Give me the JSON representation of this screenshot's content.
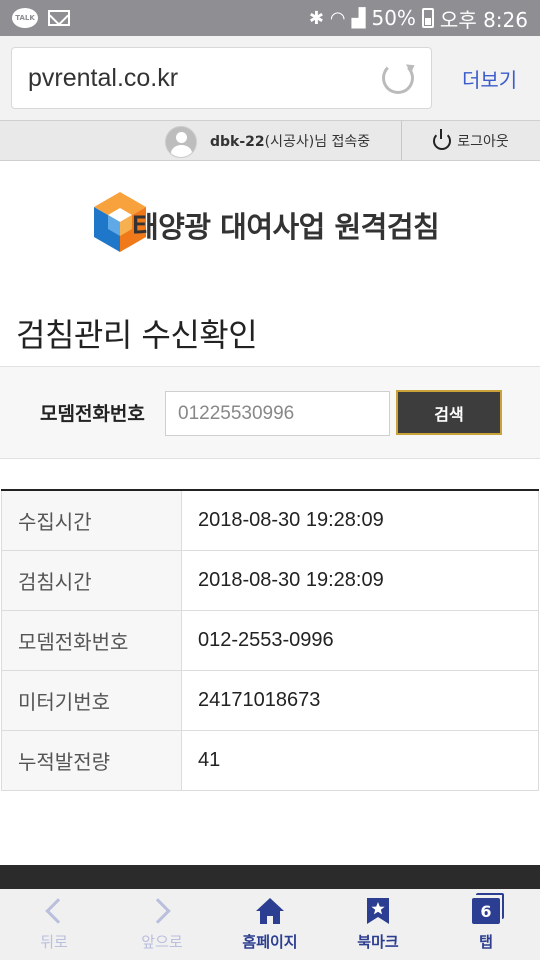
{
  "status_bar": {
    "app_icon_text": "TALK",
    "battery": "50%",
    "time": "오후 8:26"
  },
  "browser": {
    "url": "pvrental.co.kr",
    "more_label": "더보기"
  },
  "session": {
    "user_id": "dbk-22",
    "role_suffix": "(시공사)님 접속중",
    "logout_label": "로그아웃"
  },
  "logo": {
    "text": "태양광 대여사업 원격검침",
    "colors": {
      "blue": "#1f77c9",
      "orange": "#f07a1a"
    }
  },
  "page": {
    "title": "검침관리 수신확인"
  },
  "search": {
    "label": "모뎀전화번호",
    "value": "01225530996",
    "button_label": "검색"
  },
  "table": {
    "rows": [
      {
        "label": "수집시간",
        "value": "2018-08-30 19:28:09"
      },
      {
        "label": "검침시간",
        "value": "2018-08-30 19:28:09"
      },
      {
        "label": "모뎀전화번호",
        "value": "012-2553-0996"
      },
      {
        "label": "미터기번호",
        "value": "24171018673"
      },
      {
        "label": "누적발전량",
        "value": "41"
      }
    ]
  },
  "bottom_nav": {
    "back": "뒤로",
    "forward": "앞으로",
    "home": "홈페이지",
    "bookmark": "북마크",
    "tabs": "탭",
    "tab_count": "6"
  }
}
